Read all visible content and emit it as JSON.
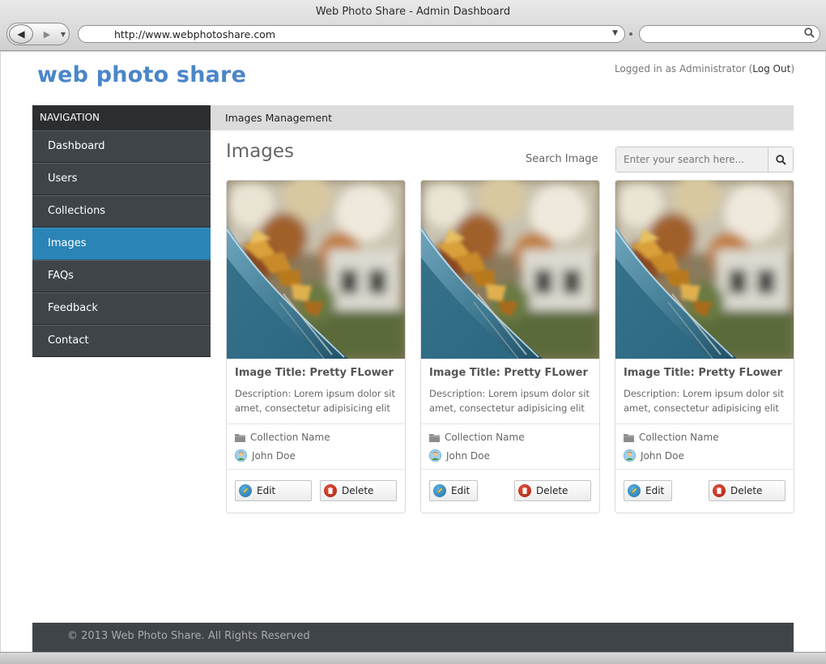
{
  "browser": {
    "window_title": "Web Photo Share - Admin Dashboard",
    "url": "http://www.webphotoshare.com",
    "search_value": ""
  },
  "header": {
    "logo": "web photo share",
    "login_prefix": "Logged in as Administrator (",
    "logout_label": "Log Out",
    "login_suffix": ")"
  },
  "sidebar": {
    "title": "NAVIGATION",
    "items": [
      {
        "label": "Dashboard",
        "active": false
      },
      {
        "label": "Users",
        "active": false
      },
      {
        "label": "Collections",
        "active": false
      },
      {
        "label": "Images",
        "active": true
      },
      {
        "label": "FAQs",
        "active": false
      },
      {
        "label": "Feedback",
        "active": false
      },
      {
        "label": "Contact",
        "active": false
      }
    ]
  },
  "main": {
    "section_title": "Images Management",
    "page_title": "Images",
    "search_label": "Search Image",
    "search_placeholder": "Enter your search here...",
    "cards": [
      {
        "title": "Image Title: Pretty FLower",
        "description": "Description: Lorem ipsum dolor sit amet, consectetur adipisicing elit",
        "collection": "Collection Name",
        "user": "John Doe",
        "edit_label": "Edit",
        "delete_label": "Delete"
      },
      {
        "title": "Image Title: Pretty FLower",
        "description": "Description: Lorem ipsum dolor sit amet, consectetur adipisicing elit",
        "collection": "Collection Name",
        "user": "John Doe",
        "edit_label": "Edit",
        "delete_label": "Delete"
      },
      {
        "title": "Image Title: Pretty FLower",
        "description": "Description: Lorem ipsum dolor sit amet, consectetur adipisicing elit",
        "collection": "Collection Name",
        "user": "John Doe",
        "edit_label": "Edit",
        "delete_label": "Delete"
      }
    ]
  },
  "footer": {
    "copyright": "© 2013 Web Photo Share. All Rights Reserved"
  },
  "colors": {
    "accent": "#2a84b6",
    "logo": "#4a86c9",
    "sidebar_bg": "#3f4449",
    "nav_header_bg": "#2b2e31",
    "section_header_bg": "#dcdcdc"
  }
}
